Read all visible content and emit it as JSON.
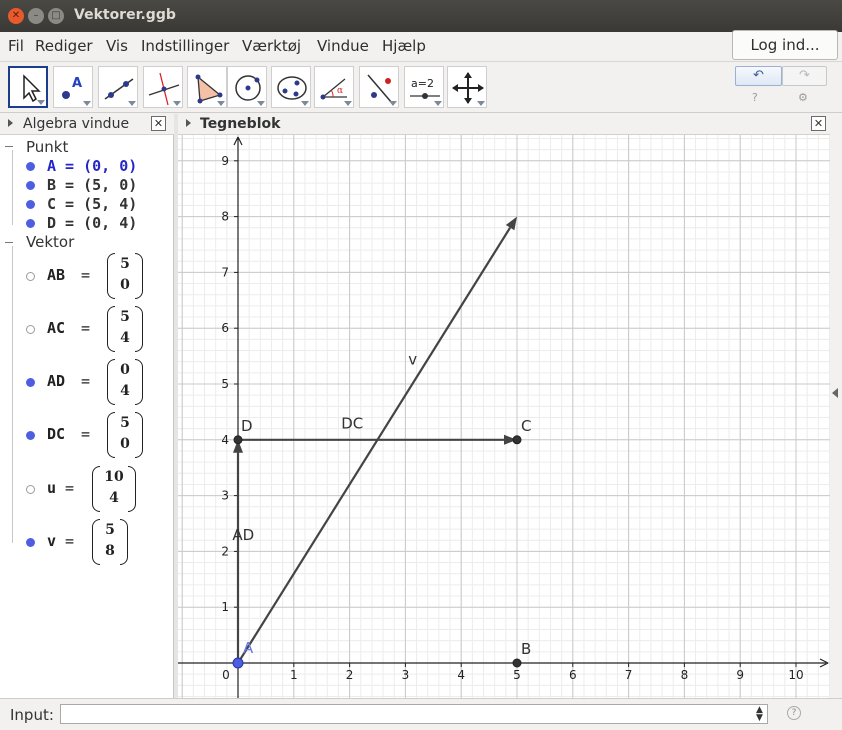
{
  "window": {
    "title": "Vektorer.ggb"
  },
  "menu": [
    "Fil",
    "Rediger",
    "Vis",
    "Indstillinger",
    "Værktøj",
    "Vindue",
    "Hjælp"
  ],
  "login_label": "Log ind...",
  "toolbar": {
    "tools": [
      "move-tool",
      "point-tool",
      "line-tool",
      "perpendicular-tool",
      "polygon-tool",
      "circle-tool",
      "conic-tool",
      "angle-tool",
      "reflect-tool",
      "slider-tool",
      "move-graphics-tool"
    ],
    "slider_label": "a=2",
    "undo_icon": "↶",
    "redo_icon": "↷",
    "help_icon": "?",
    "settings_icon": "⚙"
  },
  "algebra": {
    "title": "Algebra vindue",
    "groups": {
      "points": {
        "label": "Punkt",
        "items": [
          {
            "text": "A = (0, 0)",
            "visible": true,
            "selected": true
          },
          {
            "text": "B = (5, 0)",
            "visible": true,
            "selected": false
          },
          {
            "text": "C = (5, 4)",
            "visible": true,
            "selected": false
          },
          {
            "text": "D = (0, 4)",
            "visible": true,
            "selected": false
          }
        ]
      },
      "vectors": {
        "label": "Vektor",
        "eq": "=",
        "items": [
          {
            "name": "AB",
            "x": "5",
            "y": "0",
            "visible": false
          },
          {
            "name": "AC",
            "x": "5",
            "y": "4",
            "visible": false
          },
          {
            "name": "AD",
            "x": "0",
            "y": "4",
            "visible": true
          },
          {
            "name": "DC",
            "x": "5",
            "y": "0",
            "visible": true
          },
          {
            "name": "u",
            "x": "10",
            "y": "4",
            "visible": false
          },
          {
            "name": "v",
            "x": "5",
            "y": "8",
            "visible": true
          }
        ]
      }
    }
  },
  "graphics": {
    "title": "Tegneblok",
    "x_ticks": [
      "0",
      "1",
      "2",
      "3",
      "4",
      "5",
      "6",
      "7",
      "8",
      "9",
      "10"
    ],
    "y_ticks": [
      "1",
      "2",
      "3",
      "4",
      "5",
      "6",
      "7",
      "8",
      "9"
    ],
    "points": [
      {
        "name": "A",
        "x": 0,
        "y": 0,
        "color": "#4d5ee0"
      },
      {
        "name": "B",
        "x": 5,
        "y": 0,
        "color": "#333333"
      },
      {
        "name": "C",
        "x": 5,
        "y": 4,
        "color": "#333333"
      },
      {
        "name": "D",
        "x": 0,
        "y": 4,
        "color": "#333333"
      }
    ],
    "vectors": [
      {
        "label": "AD",
        "from": [
          0,
          0
        ],
        "to": [
          0,
          4
        ]
      },
      {
        "label": "DC",
        "from": [
          0,
          4
        ],
        "to": [
          5,
          4
        ]
      },
      {
        "label": "v",
        "from": [
          0,
          0
        ],
        "to": [
          5,
          8
        ]
      }
    ]
  },
  "inputbar": {
    "label": "Input:",
    "value": "",
    "help_icon": "?"
  },
  "colors": {
    "accent": "#4d5ee0",
    "selected_text": "#2626c8",
    "vector": "#444444",
    "grid": "#d0d0d0"
  }
}
